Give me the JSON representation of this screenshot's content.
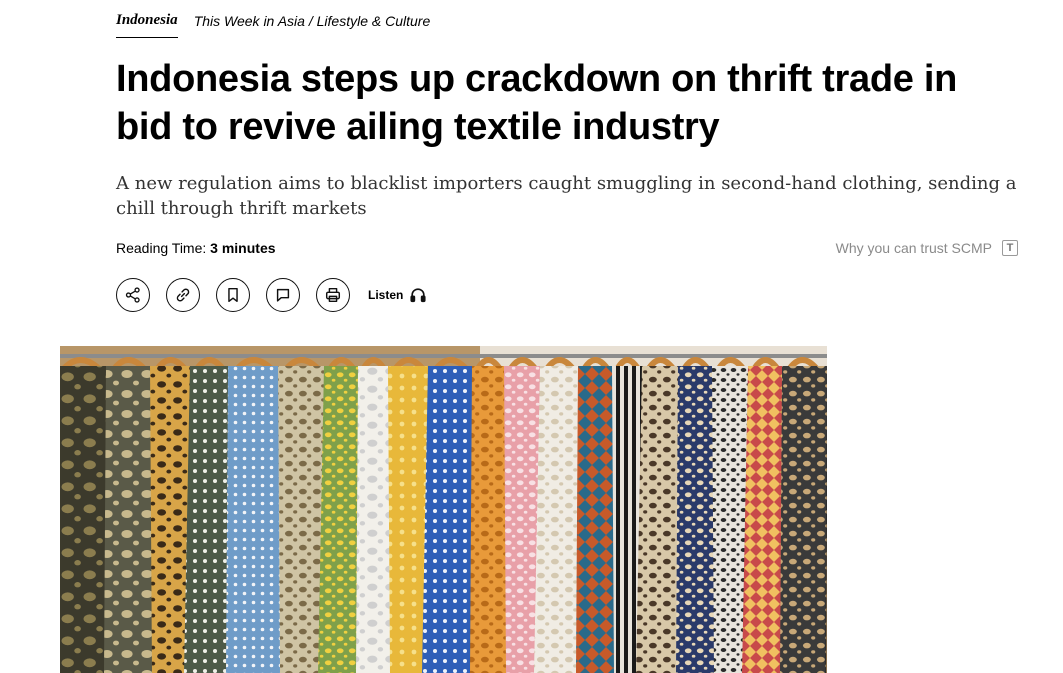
{
  "section": {
    "primary": "Indonesia",
    "crumb_1": "This Week in Asia",
    "separator": "/",
    "crumb_2": "Lifestyle & Culture"
  },
  "article": {
    "headline": "Indonesia steps up crackdown on thrift trade in bid to revive ailing textile industry",
    "subhead": "A new regulation aims to blacklist importers caught smuggling in second-hand clothing, sending a chill through thrift markets",
    "reading_time_label": "Reading Time:",
    "reading_time_value": "3 minutes",
    "trust_label": "Why you can trust SCMP"
  },
  "toolbar": {
    "listen_label": "Listen",
    "icons": [
      "share-icon",
      "link-icon",
      "bookmark-icon",
      "comment-icon",
      "print-icon",
      "headphones-icon"
    ]
  },
  "hero_image": {
    "subject": "rack of colorful patterned second-hand shirts on wooden hangers"
  },
  "colors": {
    "text": "#000000",
    "subhead_text": "#333333",
    "muted": "#8a8a8a"
  }
}
